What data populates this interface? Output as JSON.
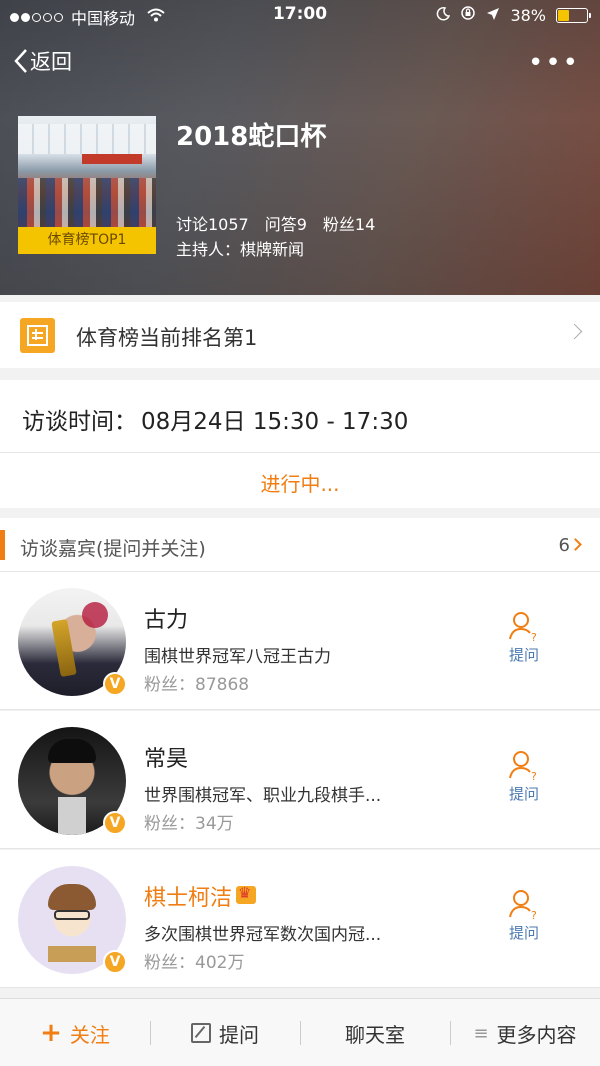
{
  "status_bar": {
    "carrier": "中国移动",
    "time": "17:00",
    "battery": "38%",
    "battery_level": 0.38
  },
  "nav": {
    "back_label": "返回",
    "more_label": "•••"
  },
  "topic": {
    "title": "2018蛇口杯",
    "cover_badge": "体育榜TOP1",
    "discussions": "讨论1057",
    "qa": "问答9",
    "fans": "粉丝14",
    "host": "主持人：棋牌新闻"
  },
  "rank": {
    "text": "体育榜当前排名第1"
  },
  "interview": {
    "label": "访谈时间：",
    "time": "08月24日 15:30 - 17:30",
    "status": "进行中..."
  },
  "guests": {
    "header": "访谈嘉宾(提问并关注)",
    "count": "6",
    "ask_label": "提问",
    "items": [
      {
        "name": "古力",
        "desc": "围棋世界冠军八冠王古力",
        "fans": "粉丝：87868",
        "verified": "V"
      },
      {
        "name": "常昊",
        "desc": "世界围棋冠军、职业九段棋手...",
        "fans": "粉丝：34万",
        "verified": "V"
      },
      {
        "name": "棋士柯洁",
        "desc": "多次围棋世界冠军数次国内冠...",
        "fans": "粉丝：402万",
        "verified": "V"
      }
    ]
  },
  "bottom_bar": {
    "follow": "关注",
    "follow_icon": "+",
    "ask": "提问",
    "chat": "聊天室",
    "more_icon": "≡",
    "more": "更多内容"
  },
  "colors": {
    "accent": "#f07e13",
    "badge": "#f5c400",
    "link": "#4a78b0"
  }
}
